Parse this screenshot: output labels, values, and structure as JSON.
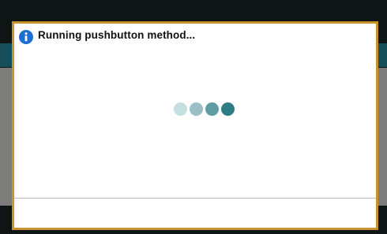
{
  "dialog": {
    "title": "Running pushbutton method...",
    "icon": "info-icon"
  },
  "spinner": {
    "dot_colors": [
      "#c5dfe1",
      "#97bfc4",
      "#5f9ba3",
      "#2e7c85"
    ]
  },
  "colors": {
    "dialog_border": "#c7922f",
    "info_icon": "#1d6fd1",
    "backdrop": "#0f1414",
    "backdrop_band": "#15505a",
    "backdrop_grey": "#7c7c7c"
  }
}
